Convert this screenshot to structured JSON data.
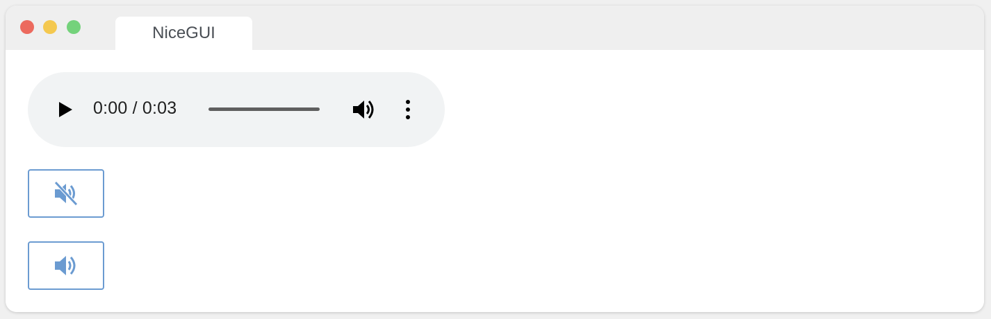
{
  "window": {
    "traffic_lights": {
      "close_color": "#ec6a5e",
      "minimize_color": "#f4c84f",
      "zoom_color": "#74d27b"
    },
    "tab": {
      "title": "NiceGUI"
    }
  },
  "audio_player": {
    "current_time": "0:00",
    "duration": "0:03",
    "time_display": "0:00 / 0:03",
    "progress_fraction": 0.0,
    "icons": {
      "play": "play-icon",
      "volume": "volume-icon",
      "menu": "more-vert-icon"
    }
  },
  "buttons": {
    "mute": {
      "icon": "volume-off-icon",
      "color": "#6b9bd1"
    },
    "unmute": {
      "icon": "volume-up-icon",
      "color": "#6b9bd1"
    }
  },
  "colors": {
    "accent": "#6b9bd1",
    "player_bg": "#f1f3f4",
    "titlebar_bg": "#efefef"
  }
}
